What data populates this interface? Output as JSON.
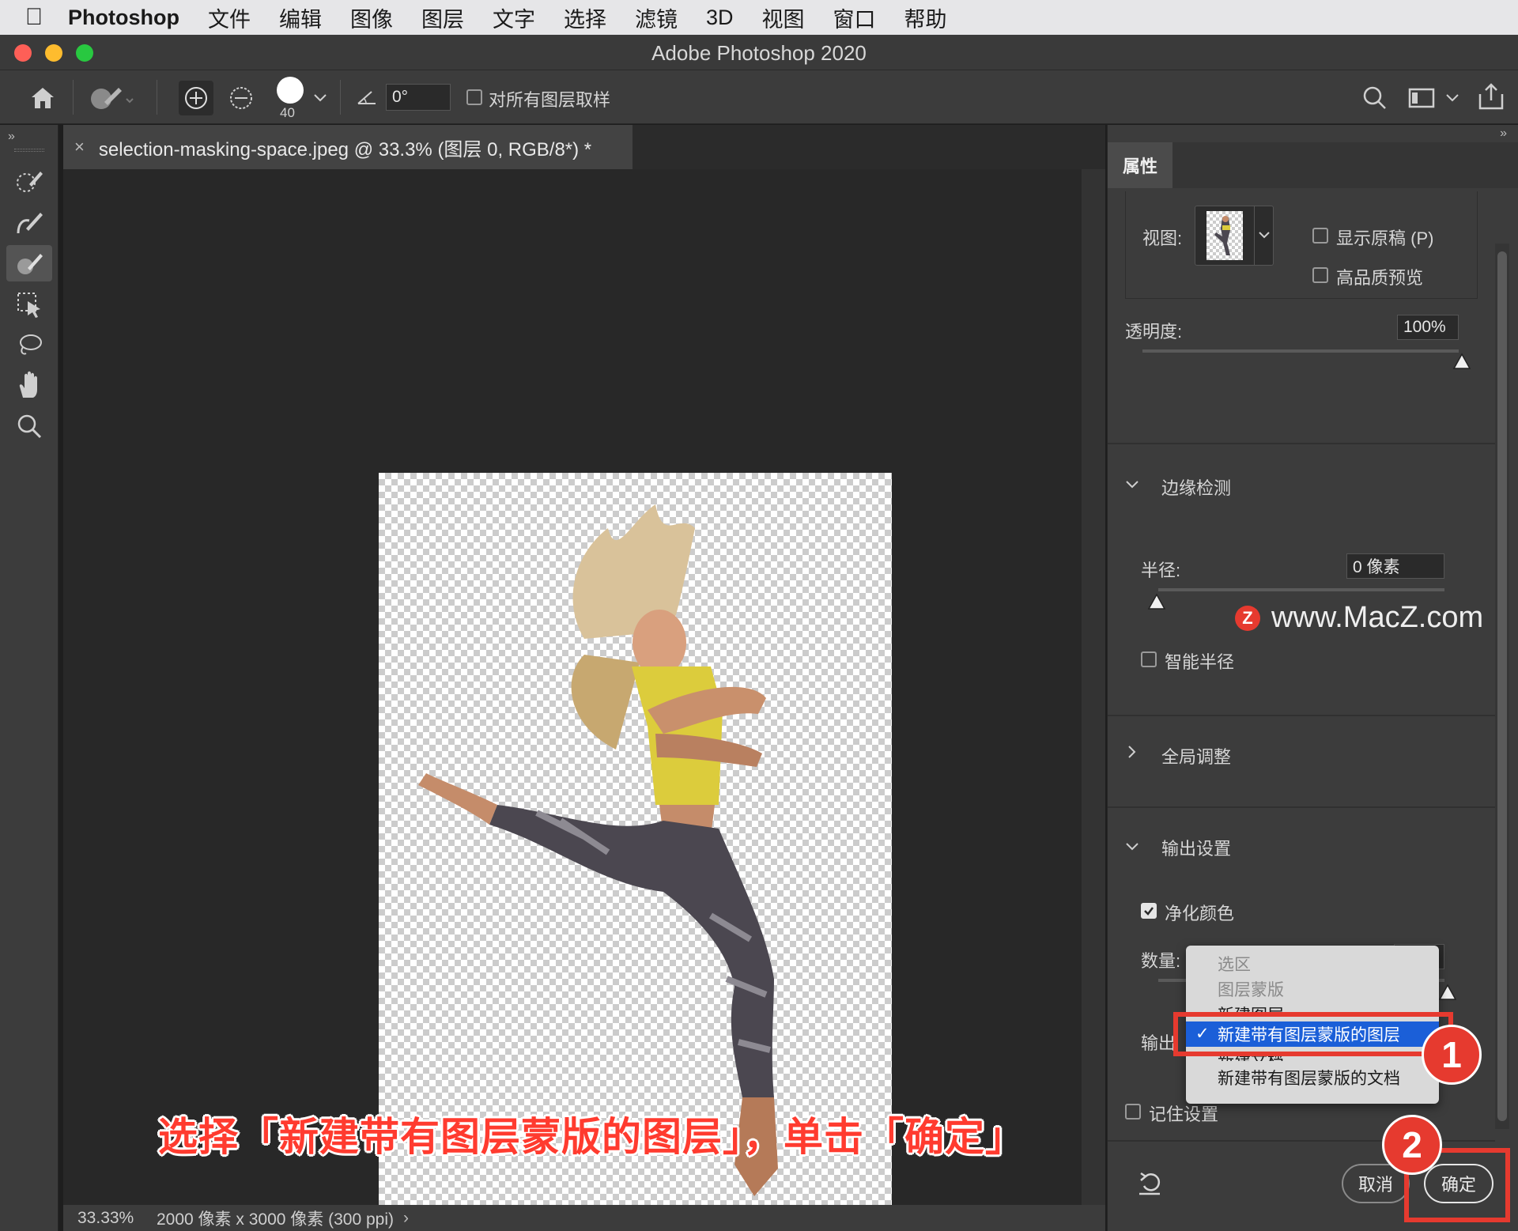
{
  "menubar": {
    "app": "Photoshop",
    "items": [
      "文件",
      "编辑",
      "图像",
      "图层",
      "文字",
      "选择",
      "滤镜",
      "3D",
      "视图",
      "窗口",
      "帮助"
    ]
  },
  "window": {
    "title": "Adobe Photoshop 2020"
  },
  "options": {
    "brush_size": "40",
    "angle": "0°",
    "sample_all_layers": "对所有图层取样"
  },
  "document": {
    "tab": "selection-masking-space.jpeg @ 33.3% (图层 0, RGB/8*) *",
    "zoom": "33.33%",
    "info": "2000 像素 x 3000 像素 (300 ppi)"
  },
  "caption": "选择「新建带有图层蒙版的图层」，单击「确定」",
  "panel": {
    "tab": "属性",
    "view_label": "视图:",
    "show_original": "显示原稿 (P)",
    "high_quality": "高品质预览",
    "opacity_label": "透明度:",
    "opacity_value": "100%",
    "edge_detection": "边缘检测",
    "radius_label": "半径:",
    "radius_value": "0 像素",
    "smart_radius": "智能半径",
    "global_adjust": "全局调整",
    "output_settings": "输出设置",
    "decontaminate": "净化颜色",
    "amount_label": "数量:",
    "output_to_label": "输出",
    "remember": "记住设置",
    "cancel": "取消",
    "ok": "确定"
  },
  "dropdown": {
    "options": [
      "选区",
      "图层蒙版",
      "新建图层",
      "新建带有图层蒙版的图层",
      "新建文档",
      "新建带有图层蒙版的文档"
    ],
    "selected": "新建带有图层蒙版的图层"
  },
  "badges": [
    "1",
    "2"
  ],
  "watermark": "www.MacZ.com"
}
